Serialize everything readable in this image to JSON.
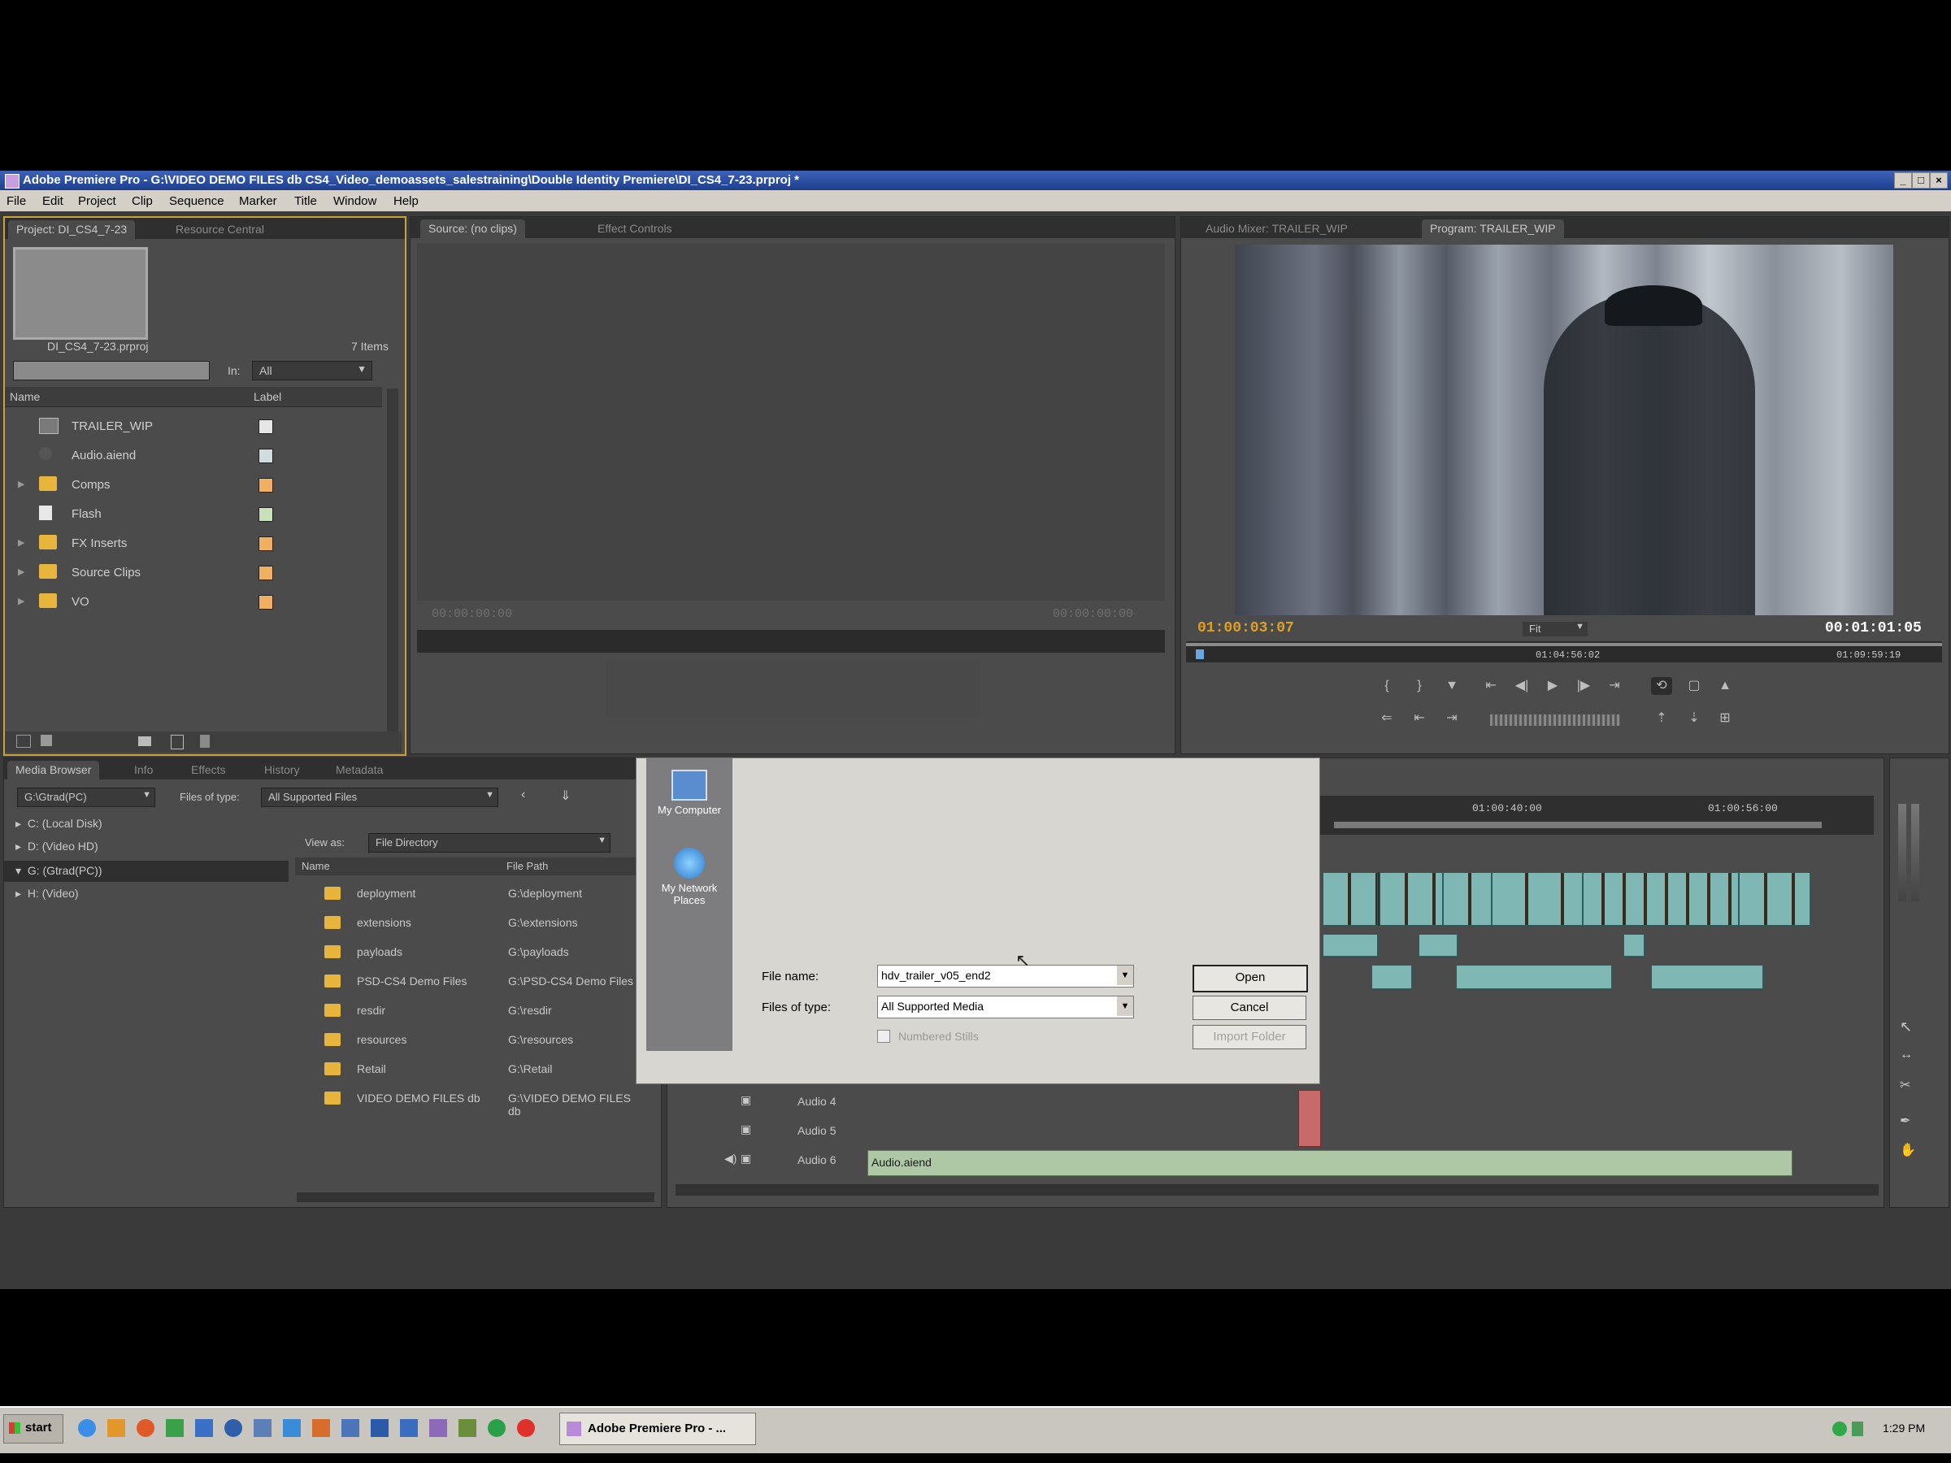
{
  "window": {
    "title": "Adobe Premiere Pro - G:\\VIDEO DEMO FILES db CS4_Video_demoassets_salestraining\\Double Identity Premiere\\DI_CS4_7-23.prproj *"
  },
  "menu": [
    "File",
    "Edit",
    "Project",
    "Clip",
    "Sequence",
    "Marker",
    "Title",
    "Window",
    "Help"
  ],
  "project_panel": {
    "tabs": [
      "Project: DI_CS4_7-23",
      "Resource Central"
    ],
    "file_name": "DI_CS4_7-23.prproj",
    "item_count": "7 Items",
    "in_label": "In:",
    "in_value": "All",
    "columns": {
      "name": "Name",
      "label": "Label"
    },
    "items": [
      {
        "name": "TRAILER_WIP",
        "color": "#e6e6e6"
      },
      {
        "name": "Audio.aiend",
        "color": "#d0dce0"
      },
      {
        "name": "Comps",
        "color": "#f0b060"
      },
      {
        "name": "Flash",
        "color": "#c9e1b8"
      },
      {
        "name": "FX Inserts",
        "color": "#f0b060"
      },
      {
        "name": "Source Clips",
        "color": "#f0b060"
      },
      {
        "name": "VO",
        "color": "#f0b060"
      }
    ]
  },
  "source_monitor": {
    "tabs": [
      "Source: (no clips)",
      "Effect Controls"
    ],
    "tc_left": "00:00:00:00",
    "tc_right": "00:00:00:00"
  },
  "program_monitor": {
    "tabs": [
      "Audio Mixer: TRAILER_WIP",
      "Program: TRAILER_WIP"
    ],
    "tc_current": "01:00:03:07",
    "tc_duration": "00:01:01:05",
    "fit": "Fit",
    "ruler_mid": "01:04:56:02",
    "ruler_right": "01:09:59:19"
  },
  "media_browser": {
    "tabs": [
      "Media Browser",
      "Info",
      "Effects",
      "History",
      "Metadata"
    ],
    "drive_select": "G:\\Gtrad(PC)",
    "files_of_type_label": "Files of type:",
    "files_of_type_value": "All Supported Files",
    "view_as_label": "View as:",
    "view_as_value": "File Directory",
    "drives": [
      "C: (Local Disk)",
      "D: (Video HD)",
      "G: (Gtrad(PC))",
      "H: (Video)"
    ],
    "columns": {
      "name": "Name",
      "path": "File Path"
    },
    "files": [
      {
        "name": "deployment",
        "path": "G:\\deployment"
      },
      {
        "name": "extensions",
        "path": "G:\\extensions"
      },
      {
        "name": "payloads",
        "path": "G:\\payloads"
      },
      {
        "name": "PSD-CS4 Demo Files",
        "path": "G:\\PSD-CS4 Demo Files"
      },
      {
        "name": "resdir",
        "path": "G:\\resdir"
      },
      {
        "name": "resources",
        "path": "G:\\resources"
      },
      {
        "name": "Retail",
        "path": "G:\\Retail"
      },
      {
        "name": "VIDEO DEMO FILES db",
        "path": "G:\\VIDEO DEMO FILES db"
      }
    ]
  },
  "open_dialog": {
    "places": [
      "My Computer",
      "My Network Places"
    ],
    "file_name_label": "File name:",
    "file_name_value": "hdv_trailer_v05_end2",
    "files_of_type_label": "Files of type:",
    "files_of_type_value": "All Supported Media",
    "open": "Open",
    "cancel": "Cancel",
    "import_folder": "Import Folder",
    "numbered_stills": "Numbered Stills"
  },
  "timeline": {
    "ruler": [
      "01:00:40:00",
      "01:00:56:00"
    ],
    "audio_tracks": [
      "Audio 4",
      "Audio 5",
      "Audio 6"
    ],
    "audio_clip": "Audio.aiend"
  },
  "taskbar": {
    "start": "start",
    "active_task": "Adobe Premiere Pro - ...",
    "clock": "1:29 PM"
  }
}
